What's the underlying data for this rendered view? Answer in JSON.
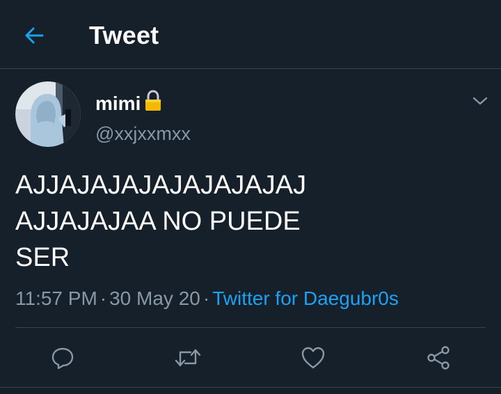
{
  "header": {
    "title": "Tweet",
    "back_icon": "arrow-left-icon"
  },
  "tweet": {
    "author": {
      "display_name": "mimi",
      "handle": "@xxjxxmxx",
      "protected_icon": "lock-icon"
    },
    "text_lines": [
      "AJJAJAJAJAJAJAJAJAJ",
      "AJJAJAJAA NO PUEDE",
      "SER"
    ],
    "time": "11:57 PM",
    "date": "30 May 20",
    "separator": "·",
    "source": "Twitter for Daegubr0s",
    "actions": [
      {
        "name": "reply",
        "icon": "reply-icon"
      },
      {
        "name": "retweet",
        "icon": "retweet-icon"
      },
      {
        "name": "like",
        "icon": "heart-icon"
      },
      {
        "name": "share",
        "icon": "share-icon"
      }
    ]
  },
  "colors": {
    "background": "#15202b",
    "text_primary": "#ffffff",
    "text_secondary": "#8899a6",
    "accent": "#1da1f2",
    "divider": "#38444d",
    "lock": "#f5b800"
  }
}
